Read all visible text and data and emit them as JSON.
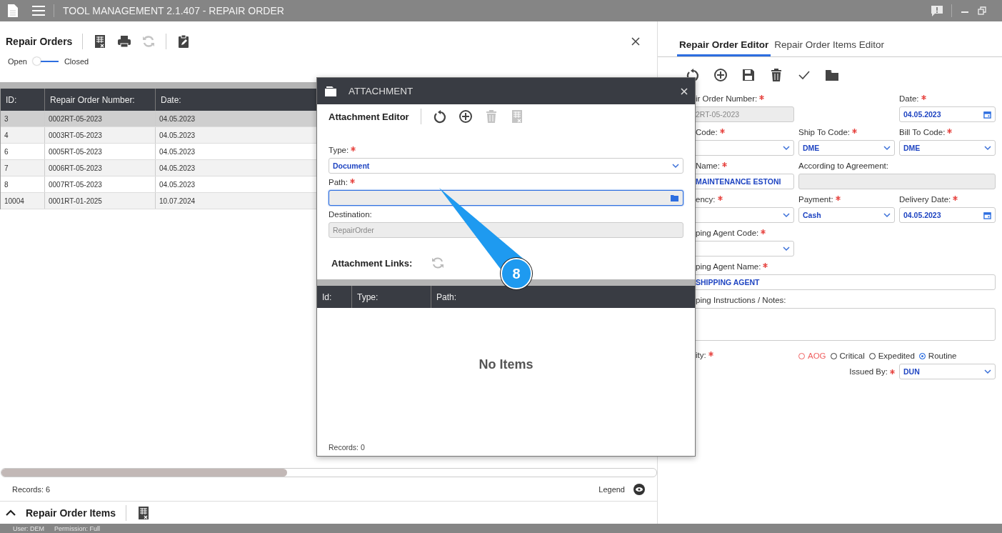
{
  "window": {
    "title": "TOOL MANAGEMENT 2.1.407 - REPAIR ORDER"
  },
  "left_panel": {
    "title": "Repair Orders",
    "toolbar": [
      {
        "kind": "excel",
        "disabled": false
      },
      {
        "kind": "print",
        "disabled": false
      },
      {
        "kind": "refresh",
        "disabled": true
      },
      {
        "kind": "clipboard",
        "disabled": false
      }
    ],
    "toggle": {
      "off_label": "Open",
      "on_label": "Closed",
      "on": false
    },
    "table": {
      "columns": [
        "ID:",
        "Repair Order Number:",
        "Date:"
      ],
      "rows": [
        {
          "cells": [
            "3",
            "0002RT-05-2023",
            "04.05.2023"
          ],
          "selected": true
        },
        {
          "cells": [
            "4",
            "0003RT-05-2023",
            "04.05.2023"
          ],
          "selected": false
        },
        {
          "cells": [
            "6",
            "0005RT-05-2023",
            "04.05.2023"
          ],
          "selected": false
        },
        {
          "cells": [
            "7",
            "0006RT-05-2023",
            "04.05.2023"
          ],
          "selected": false
        },
        {
          "cells": [
            "8",
            "0007RT-05-2023",
            "04.05.2023"
          ],
          "selected": false
        },
        {
          "cells": [
            "10004",
            "0001RT-01-2025",
            "10.07.2024"
          ],
          "selected": false
        }
      ]
    },
    "records": "Records: 6",
    "legend": "Legend"
  },
  "items_section": {
    "title": "Repair Order Items",
    "expanded": true
  },
  "status_bar": {
    "user": "User: DEM",
    "permission": "Permission: Full"
  },
  "right_panel": {
    "tabs": [
      {
        "label": "Repair Order Editor",
        "selected": true
      },
      {
        "label": "Repair Order Items Editor",
        "selected": false
      }
    ],
    "toolbar": [
      {
        "kind": "undo",
        "disabled": false
      },
      {
        "kind": "add",
        "disabled": false
      },
      {
        "kind": "save",
        "disabled": false
      },
      {
        "kind": "delete",
        "disabled": false
      },
      {
        "kind": "check",
        "disabled": false
      },
      {
        "kind": "folder",
        "disabled": false
      }
    ],
    "fields": [
      {
        "label": "ir Order Number:",
        "required": true,
        "kind": "readonly",
        "value": "2RT-05-2023"
      },
      {
        "label": "Date:",
        "required": true,
        "kind": "date",
        "value": "04.05.2023"
      },
      {
        "label": "Code:",
        "required": true,
        "kind": "select"
      },
      {
        "label": "Ship To Code:",
        "required": true,
        "kind": "select",
        "value": "DME"
      },
      {
        "label": "Bill To Code:",
        "required": true,
        "kind": "select",
        "value": "DME"
      },
      {
        "label": "Name:",
        "required": true,
        "kind": "text",
        "value": "MAINTENANCE ESTONI"
      },
      {
        "label": "According to Agreement:",
        "required": false,
        "kind": "readonly"
      },
      {
        "label": "ency:",
        "required": true,
        "kind": "select"
      },
      {
        "label": "Payment:",
        "required": true,
        "kind": "select",
        "value": "Cash"
      },
      {
        "label": "Delivery Date:",
        "required": true,
        "kind": "date",
        "value": "04.05.2023"
      },
      {
        "label": "ping Agent Code:",
        "required": true,
        "kind": "select"
      },
      {
        "label": "ping Agent Name:",
        "required": true,
        "kind": "text",
        "value": "SHIPPING AGENT"
      },
      {
        "label": "ping Instructions / Notes:",
        "required": false,
        "kind": "textarea"
      }
    ],
    "priority": {
      "label": "ity:",
      "required": true,
      "options": [
        {
          "label": "AOG",
          "selected": false,
          "color": "#f06060"
        },
        {
          "label": "Critical",
          "selected": false,
          "color": "#333333"
        },
        {
          "label": "Expedited",
          "selected": false,
          "color": "#333333"
        },
        {
          "label": "Routine",
          "selected": true,
          "color": "#333333"
        }
      ]
    },
    "issued_by": {
      "label": "Issued By:",
      "required": true,
      "value": "DUN"
    }
  },
  "dialog": {
    "title": "ATTACHMENT",
    "editor_title": "Attachment Editor",
    "toolbar": [
      {
        "kind": "undo",
        "disabled": false
      },
      {
        "kind": "add",
        "disabled": false
      },
      {
        "kind": "delete",
        "disabled": true
      },
      {
        "kind": "excel",
        "disabled": true
      }
    ],
    "type": {
      "label": "Type:",
      "required": true,
      "value": "Document"
    },
    "path": {
      "label": "Path:",
      "required": true,
      "focused": true
    },
    "destination": {
      "label": "Destination:",
      "value": "RepairOrder"
    },
    "links_title": "Attachment Links:",
    "links_table": {
      "columns": [
        "Id:",
        "Type:",
        "Path:"
      ],
      "empty_text": "No Items"
    },
    "records": "Records: 0"
  },
  "callout": {
    "number": "8"
  }
}
